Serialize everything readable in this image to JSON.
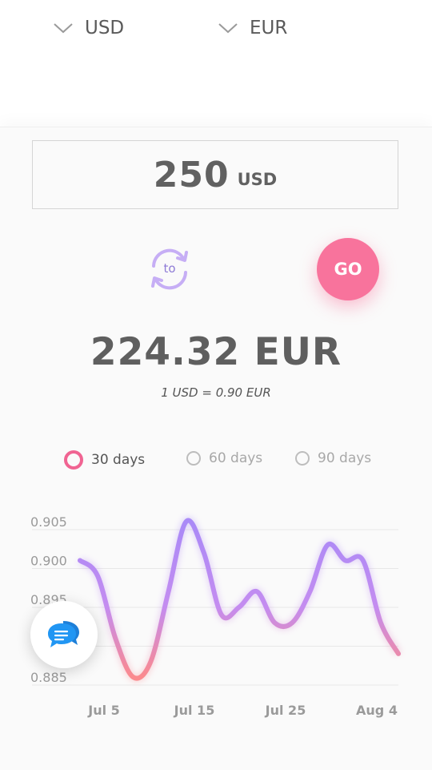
{
  "converter": {
    "amount": "250",
    "amount_unit": "USD",
    "from_currency": "USD",
    "to_currency": "EUR",
    "swap_label": "to",
    "go_label": "GO",
    "result": "224.32 EUR",
    "rate": "1 USD = 0.90 EUR"
  },
  "range_options": [
    {
      "label": "30 days",
      "selected": true
    },
    {
      "label": "60 days",
      "selected": false
    },
    {
      "label": "90 days",
      "selected": false
    }
  ],
  "colors": {
    "accent_pink": "#f8739c",
    "line_purple": "#b28cf5",
    "line_coral": "#f9869a",
    "text": "#5f5f5f"
  },
  "icons": {
    "dropdown": "chevron-down-icon",
    "swap": "swap-arrows-icon",
    "chat": "chat-bubbles-icon"
  },
  "chart_data": {
    "type": "line",
    "x_tick_labels": [
      "Jul 5",
      "Jul 15",
      "Jul 25",
      "Aug 4"
    ],
    "y_tick_labels": [
      "0.905",
      "0.900",
      "0.895",
      "0.890",
      "0.885"
    ],
    "ylim": [
      0.885,
      0.905
    ],
    "grid": true,
    "series": [
      {
        "values": [
          0.9,
          0.898,
          0.89,
          0.885,
          0.887,
          0.896,
          0.905,
          0.901,
          0.893,
          0.894,
          0.896,
          0.892,
          0.892,
          0.896,
          0.902,
          0.9,
          0.9,
          0.892,
          0.888
        ]
      }
    ]
  }
}
